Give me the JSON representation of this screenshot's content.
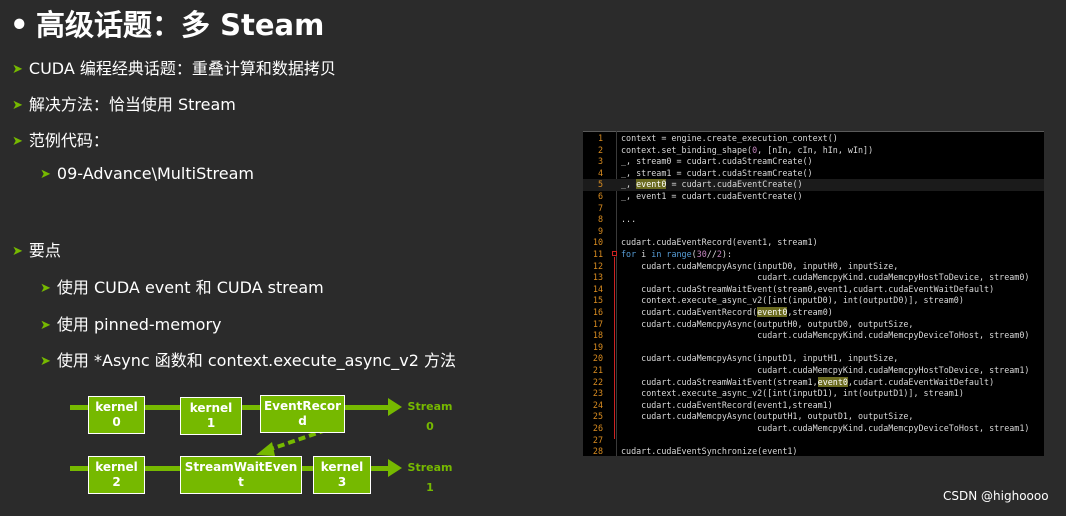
{
  "slide": {
    "title": "高级话题：多 Steam",
    "bullets": [
      "CUDA 编程经典话题：重叠计算和数据拷贝",
      "解决方法：恰当使用 Stream",
      "范例代码：",
      "09-Advance\\MultiStream",
      "要点",
      "使用 CUDA event 和 CUDA stream",
      "使用 pinned-memory",
      "使用 *Async 函数和 context.execute_async_v2 方法"
    ]
  },
  "code": {
    "lines": [
      {
        "n": "1",
        "t": "context = engine.create_execution_context()"
      },
      {
        "n": "2",
        "t": "context.set_binding_shape(0, [nIn, cIn, hIn, wIn])"
      },
      {
        "n": "3",
        "t": "_, stream0 = cudart.cudaStreamCreate()"
      },
      {
        "n": "4",
        "t": "_, stream1 = cudart.cudaStreamCreate()"
      },
      {
        "n": "5",
        "t": "_, event0 = cudart.cudaEventCreate()"
      },
      {
        "n": "6",
        "t": "_, event1 = cudart.cudaEventCreate()"
      },
      {
        "n": "7",
        "t": ""
      },
      {
        "n": "8",
        "t": "..."
      },
      {
        "n": "9",
        "t": ""
      },
      {
        "n": "10",
        "t": "cudart.cudaEventRecord(event1, stream1)"
      },
      {
        "n": "11",
        "t": "for i in range(30//2):"
      },
      {
        "n": "12",
        "t": "    cudart.cudaMemcpyAsync(inputD0, inputH0, inputSize,"
      },
      {
        "n": "13",
        "t": "                           cudart.cudaMemcpyKind.cudaMemcpyHostToDevice, stream0)"
      },
      {
        "n": "14",
        "t": "    cudart.cudaStreamWaitEvent(stream0,event1,cudart.cudaEventWaitDefault)"
      },
      {
        "n": "15",
        "t": "    context.execute_async_v2([int(inputD0), int(outputD0)], stream0)"
      },
      {
        "n": "16",
        "t": "    cudart.cudaEventRecord(event0,stream0)"
      },
      {
        "n": "17",
        "t": "    cudart.cudaMemcpyAsync(outputH0, outputD0, outputSize,"
      },
      {
        "n": "18",
        "t": "                           cudart.cudaMemcpyKind.cudaMemcpyDeviceToHost, stream0)"
      },
      {
        "n": "19",
        "t": ""
      },
      {
        "n": "20",
        "t": "    cudart.cudaMemcpyAsync(inputD1, inputH1, inputSize,"
      },
      {
        "n": "21",
        "t": "                           cudart.cudaMemcpyKind.cudaMemcpyHostToDevice, stream1)"
      },
      {
        "n": "22",
        "t": "    cudart.cudaStreamWaitEvent(stream1,event0,cudart.cudaEventWaitDefault)"
      },
      {
        "n": "23",
        "t": "    context.execute_async_v2([int(inputD1), int(outputD1)], stream1)"
      },
      {
        "n": "24",
        "t": "    cudart.cudaEventRecord(event1,stream1)"
      },
      {
        "n": "25",
        "t": "    cudart.cudaMemcpyAsync(outputH1, outputD1, outputSize,"
      },
      {
        "n": "26",
        "t": "                           cudart.cudaMemcpyKind.cudaMemcpyDeviceToHost, stream1)"
      },
      {
        "n": "27",
        "t": ""
      },
      {
        "n": "28",
        "t": "cudart.cudaEventSynchronize(event1)"
      }
    ]
  },
  "diagram": {
    "stream0": {
      "label_line1": "Stream",
      "label_line2": "0"
    },
    "stream1": {
      "label_line1": "Stream",
      "label_line2": "1"
    },
    "boxes": {
      "k0": {
        "l1": "kernel",
        "l2": "0"
      },
      "k1": {
        "l1": "kernel",
        "l2": "1"
      },
      "er": {
        "l1": "EventRecor",
        "l2": "d"
      },
      "k2": {
        "l1": "kernel",
        "l2": "2"
      },
      "sw": {
        "l1": "StreamWaitEven",
        "l2": "t"
      },
      "k3": {
        "l1": "kernel",
        "l2": "3"
      }
    }
  },
  "watermark": "CSDN @highoooo",
  "colors": {
    "accent": "#76b900",
    "background": "#2b2b2b",
    "code_bg": "#000000",
    "line_number": "#d98c20"
  }
}
